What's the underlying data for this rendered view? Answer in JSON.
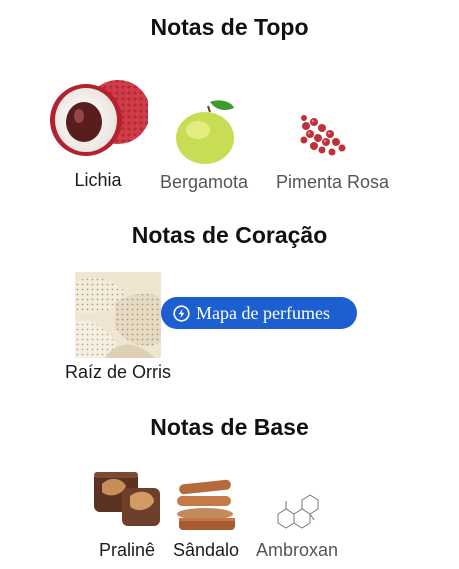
{
  "sections": [
    {
      "title": "Notas de Topo",
      "notes": [
        {
          "label": "Lichia",
          "icon": "lychee-icon"
        },
        {
          "label": "Bergamota",
          "icon": "bergamot-icon"
        },
        {
          "label": "Pimenta Rosa",
          "icon": "pink-pepper-icon"
        }
      ]
    },
    {
      "title": "Notas de Coração",
      "notes": [
        {
          "label": "Raíz de Orris",
          "icon": "orris-root-icon"
        }
      ]
    },
    {
      "title": "Notas de Base",
      "notes": [
        {
          "label": "Pralinê",
          "icon": "praline-icon"
        },
        {
          "label": "Sândalo",
          "icon": "sandalwood-icon"
        },
        {
          "label": "Ambroxan",
          "icon": "ambroxan-molecule-icon"
        }
      ]
    }
  ],
  "perfume_map_button": {
    "label": "Mapa de perfumes",
    "icon": "lightning-circle-icon"
  },
  "colors": {
    "button": "#1b5fd1",
    "title": "#111111",
    "label_dark": "#1a1a1a",
    "label_grey": "#555555"
  }
}
